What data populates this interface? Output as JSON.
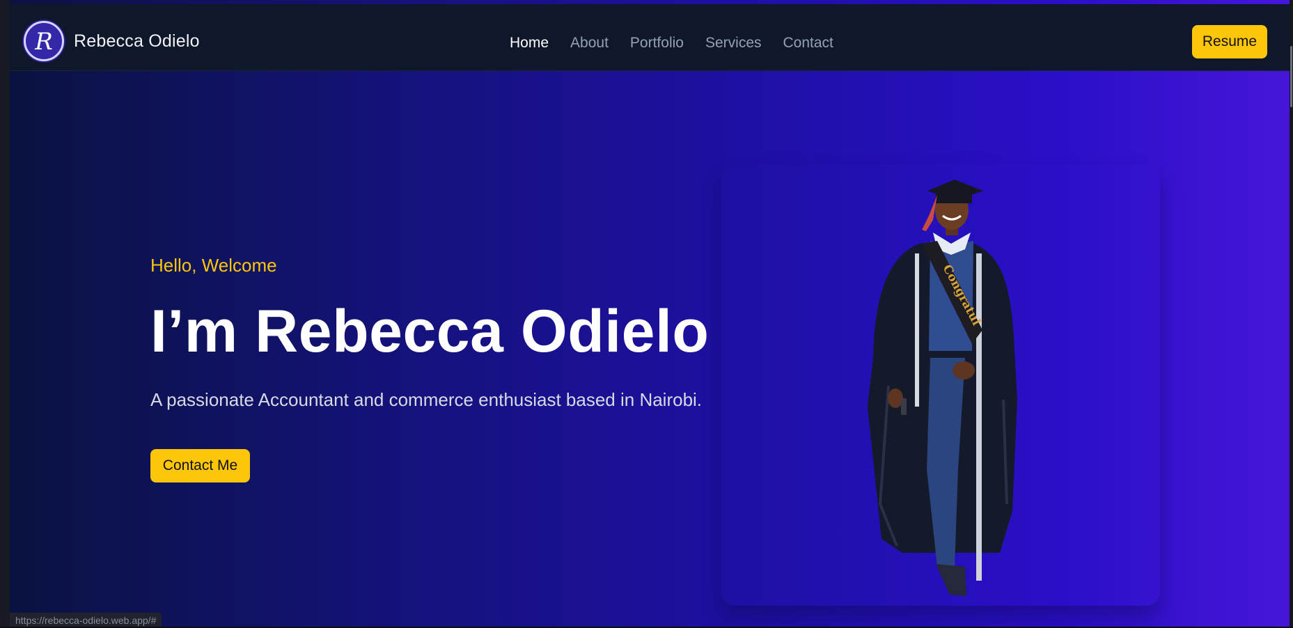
{
  "brand": {
    "name": "Rebecca Odielo",
    "logo_letter": "R"
  },
  "nav": {
    "items": [
      {
        "label": "Home",
        "active": true
      },
      {
        "label": "About",
        "active": false
      },
      {
        "label": "Portfolio",
        "active": false
      },
      {
        "label": "Services",
        "active": false
      },
      {
        "label": "Contact",
        "active": false
      }
    ],
    "resume_label": "Resume"
  },
  "hero": {
    "greeting": "Hello, Welcome",
    "title": "I’m Rebecca Odielo",
    "description": "A passionate Accountant and commerce enthusiast based in Nairobi.",
    "cta_label": "Contact Me",
    "sash_text": "Congratul"
  },
  "status_bar": {
    "url": "https://rebecca-odielo.web.app/#"
  },
  "colors": {
    "accent": "#fcc60a",
    "navbar_bg": "#0f172a",
    "gradient_start": "#0a1240",
    "gradient_end": "#4616d8"
  }
}
